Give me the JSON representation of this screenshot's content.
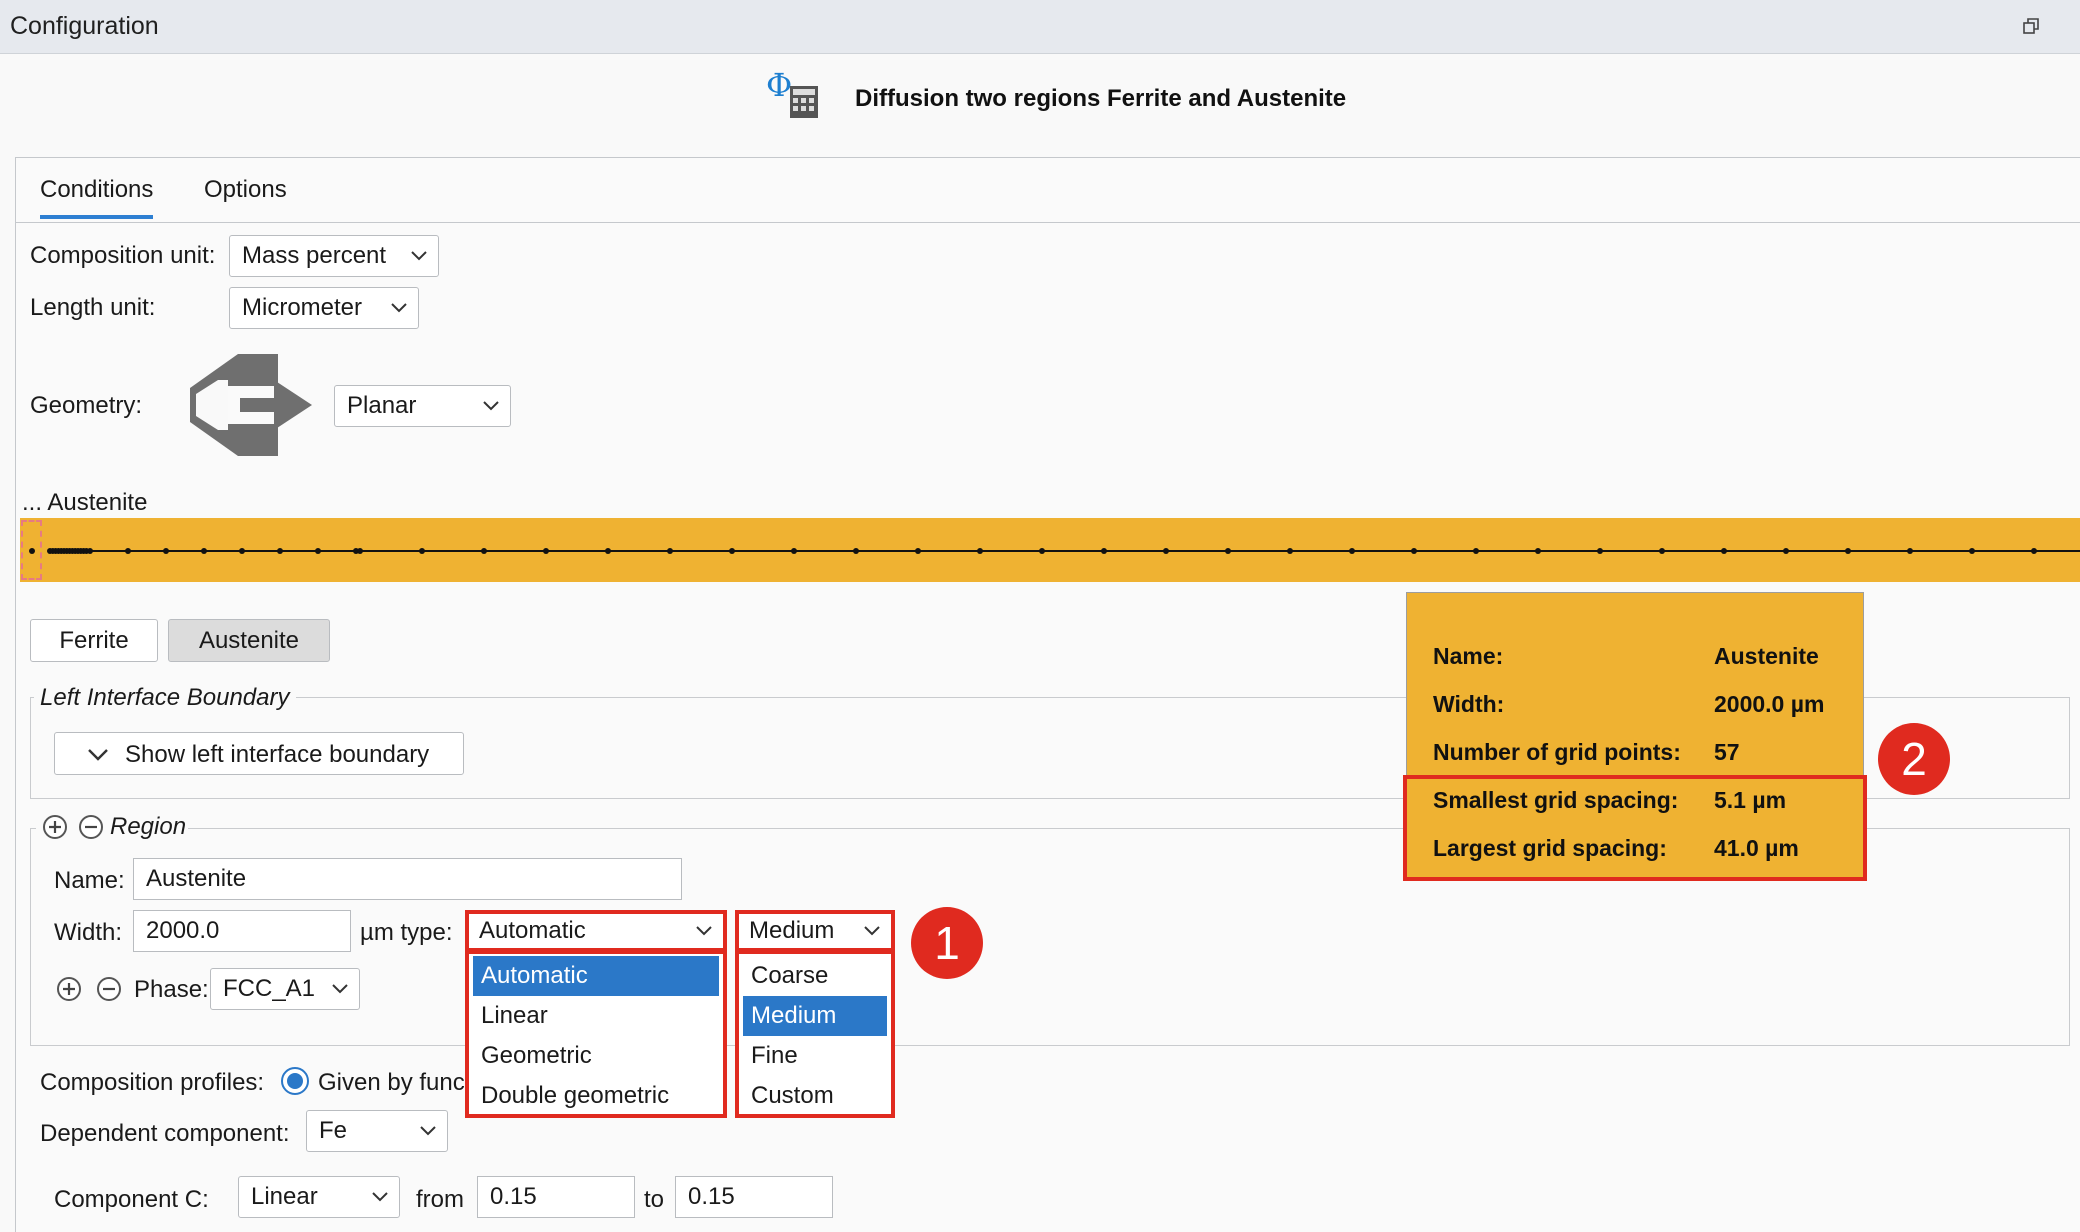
{
  "window": {
    "title": "Configuration"
  },
  "header": {
    "title": "Diffusion two regions Ferrite and Austenite",
    "icon": "diffusion-calculator-icon"
  },
  "tabs": [
    {
      "label": "Conditions",
      "active": true
    },
    {
      "label": "Options",
      "active": false
    }
  ],
  "conditions": {
    "composition_unit": {
      "label": "Composition unit:",
      "value": "Mass percent"
    },
    "length_unit": {
      "label": "Length unit:",
      "value": "Micrometer"
    },
    "geometry": {
      "label": "Geometry:",
      "value": "Planar",
      "icon": "planar-geometry-icon"
    }
  },
  "grid_preview": {
    "label": "... Austenite",
    "bar_color": "#efb232"
  },
  "region_buttons": [
    {
      "label": "Ferrite"
    },
    {
      "label": "Austenite",
      "pressed": true
    }
  ],
  "left_interface": {
    "legend": "Left Interface Boundary",
    "button": "Show left interface boundary"
  },
  "region": {
    "legend": "Region",
    "name_label": "Name:",
    "name_value": "Austenite",
    "width_label": "Width:",
    "width_value": "2000.0",
    "unit_type_label": "µm  type:",
    "type_value": "Automatic",
    "type_options": [
      "Automatic",
      "Linear",
      "Geometric",
      "Double geometric"
    ],
    "density_value": "Medium",
    "density_options": [
      "Coarse",
      "Medium",
      "Fine",
      "Custom"
    ],
    "phase_label": "Phase:",
    "phase_value": "FCC_A1"
  },
  "composition": {
    "profiles_label": "Composition profiles:",
    "profiles_option": "Given by func",
    "dependent_label": "Dependent component:",
    "dependent_value": "Fe",
    "component_label": "Component C:",
    "component_type": "Linear",
    "from_label": "from",
    "from_value": "0.15",
    "to_label": "to",
    "to_value": "0.15"
  },
  "tooltip": {
    "rows": [
      {
        "label": "Name:",
        "value": "Austenite"
      },
      {
        "label": "Width:",
        "value": "2000.0 µm"
      },
      {
        "label": "Number of grid points:",
        "value": "57"
      },
      {
        "label": "Smallest grid spacing:",
        "value": "5.1 µm"
      },
      {
        "label": "Largest grid spacing:",
        "value": "41.0 µm"
      }
    ]
  },
  "callouts": [
    {
      "label": "1"
    },
    {
      "label": "2"
    }
  ],
  "colors": {
    "accent": "#2b78c8",
    "highlight": "#e02a1f",
    "region": "#efb232"
  }
}
